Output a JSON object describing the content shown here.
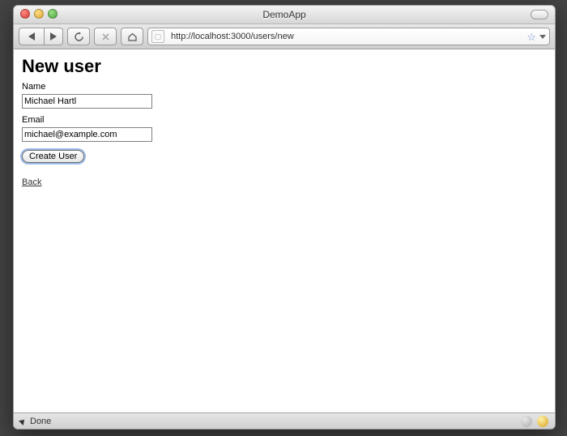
{
  "window": {
    "title": "DemoApp"
  },
  "toolbar": {
    "url": "http://localhost:3000/users/new"
  },
  "page": {
    "heading": "New user",
    "name_label": "Name",
    "name_value": "Michael Hartl",
    "email_label": "Email",
    "email_value": "michael@example.com",
    "submit_label": "Create User",
    "back_link": "Back"
  },
  "status": {
    "text": "Done"
  }
}
